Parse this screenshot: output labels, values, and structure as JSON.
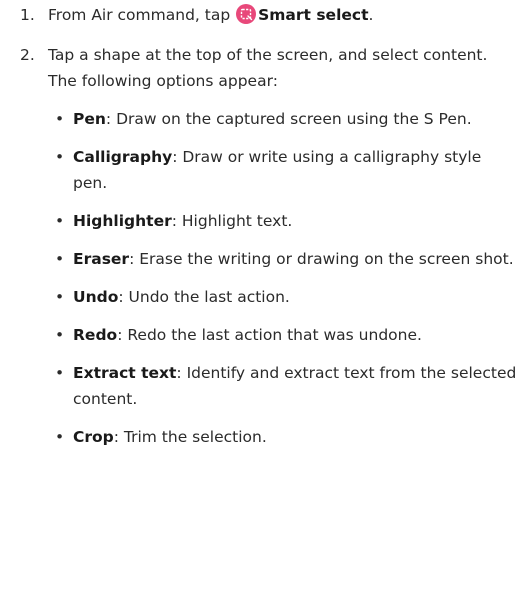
{
  "steps": [
    {
      "number": "1.",
      "text_before": "From Air command, tap ",
      "icon": "smart-select-icon",
      "bold": "Smart select",
      "text_after": "."
    },
    {
      "number": "2.",
      "text": "Tap a shape at the top of the screen, and select content. The following options appear:",
      "options": [
        {
          "term": "Pen",
          "desc": ": Draw on the captured screen using the S Pen."
        },
        {
          "term": "Calligraphy",
          "desc": ": Draw or write using a calligraphy style pen."
        },
        {
          "term": "Highlighter",
          "desc": ": Highlight text."
        },
        {
          "term": "Eraser",
          "desc": ": Erase the writing or drawing on the screen shot."
        },
        {
          "term": "Undo",
          "desc": ": Undo the last action."
        },
        {
          "term": "Redo",
          "desc": ": Redo the last action that was undone."
        },
        {
          "term": "Extract text",
          "desc": ": Identify and extract text from the selected content."
        },
        {
          "term": "Crop",
          "desc": ": Trim the selection."
        }
      ]
    }
  ],
  "bullet_char": "•",
  "colors": {
    "text": "#2b2b2b",
    "icon_bg": "#e8487a"
  }
}
